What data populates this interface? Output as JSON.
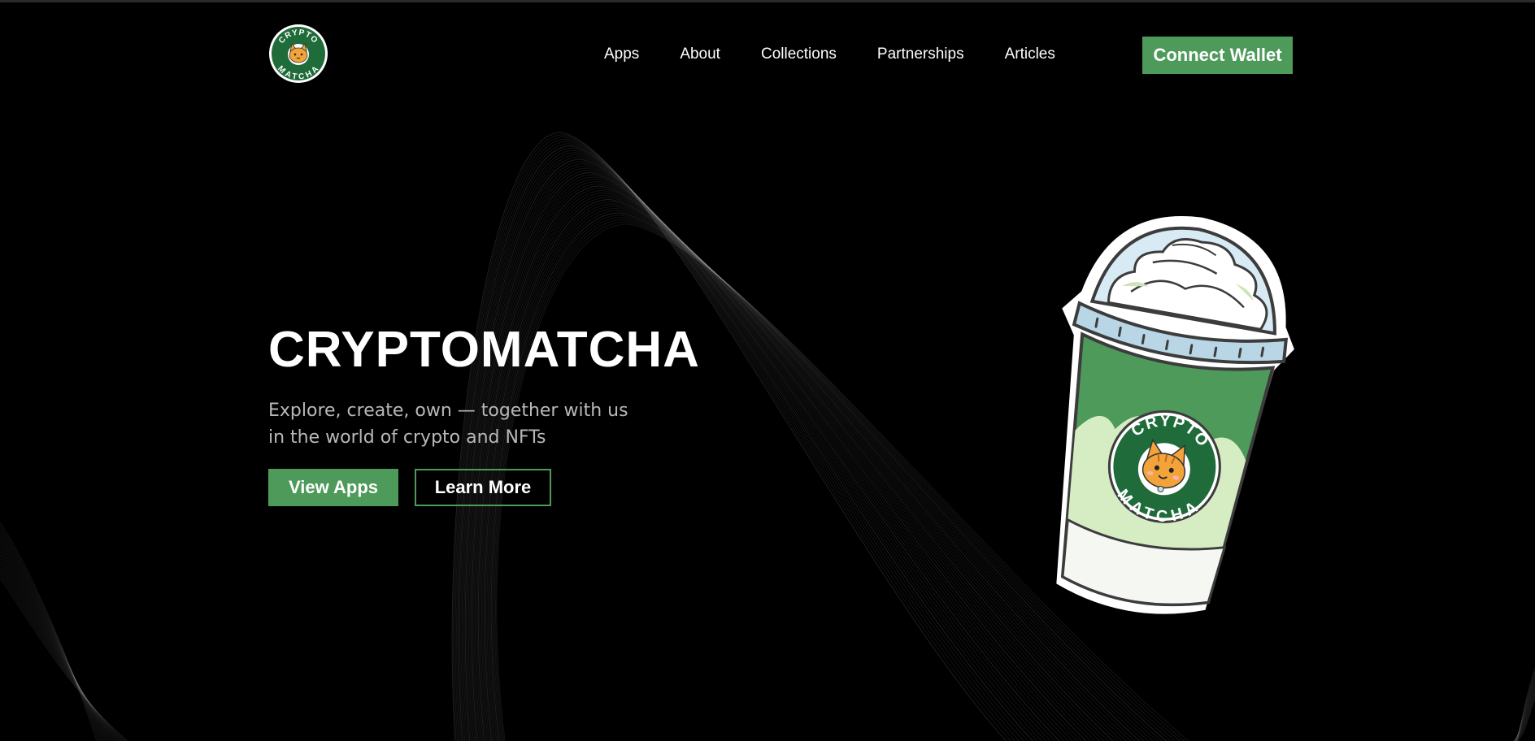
{
  "brand": {
    "logo_top_text": "CRYPTO",
    "logo_bottom_text": "MATCHA",
    "primary_color": "#4e9a5a",
    "dark_green": "#1f6b3a",
    "background": "#000000"
  },
  "nav": {
    "items": [
      {
        "label": "Apps"
      },
      {
        "label": "About"
      },
      {
        "label": "Collections"
      },
      {
        "label": "Partnerships"
      },
      {
        "label": "Articles"
      }
    ],
    "connect_label": "Connect Wallet"
  },
  "hero": {
    "title": "CRYPTOMATCHA",
    "subtitle_line1": "Explore, create, own — together with us",
    "subtitle_line2": "in the world of crypto and NFTs",
    "primary_button": "View Apps",
    "secondary_button": "Learn More"
  },
  "illustration": {
    "name": "matcha-frappe-cup",
    "badge_top_text": "CRYPTO",
    "badge_bottom_text": "MATCHA"
  }
}
